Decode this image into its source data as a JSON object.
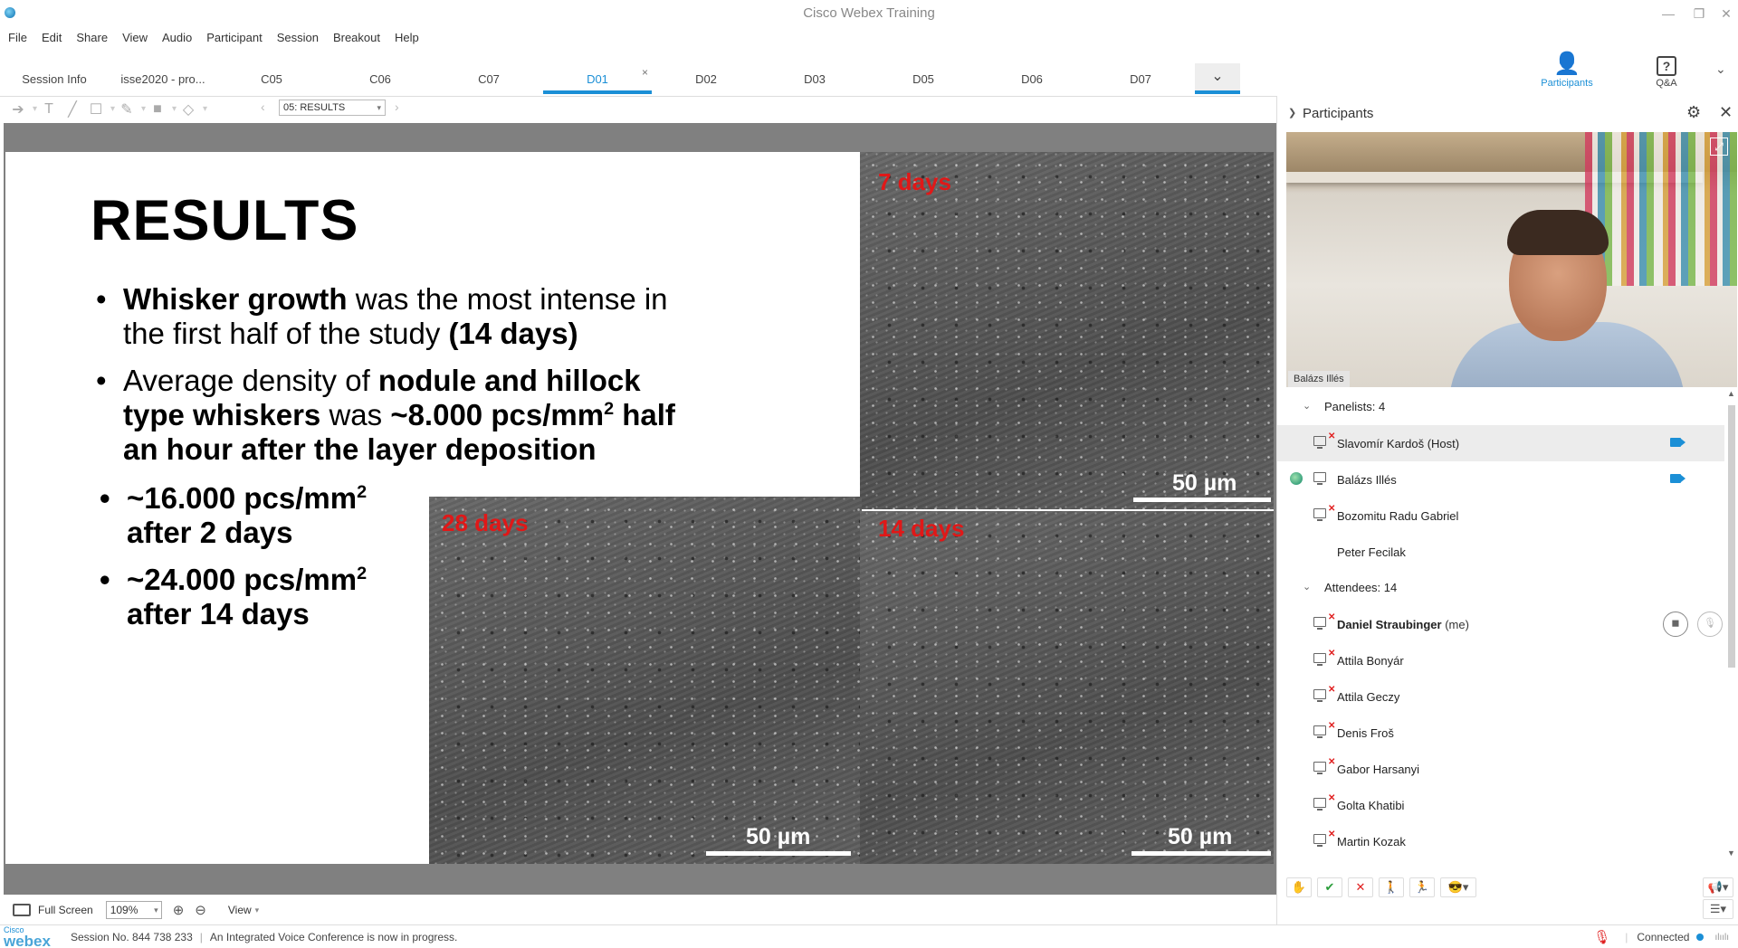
{
  "window": {
    "title": "Cisco Webex Training"
  },
  "menu": [
    "File",
    "Edit",
    "Share",
    "View",
    "Audio",
    "Participant",
    "Session",
    "Breakout",
    "Help"
  ],
  "tabs": [
    {
      "label": "Session Info",
      "active": false
    },
    {
      "label": "isse2020 - pro...",
      "active": false
    },
    {
      "label": "C05",
      "active": false
    },
    {
      "label": "C06",
      "active": false
    },
    {
      "label": "C07",
      "active": false
    },
    {
      "label": "D01",
      "active": true
    },
    {
      "label": "D02",
      "active": false
    },
    {
      "label": "D03",
      "active": false
    },
    {
      "label": "D05",
      "active": false
    },
    {
      "label": "D06",
      "active": false
    },
    {
      "label": "D07",
      "active": false
    }
  ],
  "panel_buttons": {
    "participants": "Participants",
    "qa": "Q&A"
  },
  "toolbar": {
    "page": "05: RESULTS"
  },
  "slide": {
    "title": "RESULTS",
    "b1_bold": "Whisker growth",
    "b1_text": " was the most intense in the first half of the study ",
    "b1_bold2": "(14 days)",
    "b2_text": "Average density of ",
    "b2_bold": "nodule and hillock type whiskers",
    "b2_text2": " was ",
    "b2_bold2": "~8.000 pcs/mm",
    "b2_bold3": " half an hour after the layer deposition",
    "b3_line1": "~16.000 pcs/mm",
    "b3_line2": "after 2 days",
    "b4_line1": "~24.000 pcs/mm",
    "b4_line2": "after 14 days",
    "sup": "2",
    "sem": {
      "d7": "7 days",
      "d14": "14 days",
      "d28": "28 days",
      "scale": "50 µm"
    }
  },
  "bottom": {
    "fullscreen": "Full Screen",
    "zoom": "109%",
    "view": "View"
  },
  "status": {
    "logo_small": "Cisco",
    "logo_big": "webex",
    "session": "Session No. 844 738 233",
    "message": "An Integrated Voice Conference is now in progress.",
    "connected": "Connected"
  },
  "participants": {
    "title": "Participants",
    "video_name": "Balázs Illés",
    "panelists_label": "Panelists: 4",
    "panelists": [
      {
        "name": "Slavomír Kardoš (Host)"
      },
      {
        "name": "Balázs Illés"
      },
      {
        "name": "Bozomitu Radu Gabriel"
      },
      {
        "name": "Peter Fecilak"
      }
    ],
    "attendees_label": "Attendees: 14",
    "me_name": "Daniel Straubinger",
    "me_tag": " (me)",
    "attendees": [
      {
        "name": "Attila Bonyár"
      },
      {
        "name": "Attila Geczy"
      },
      {
        "name": "Denis Froš"
      },
      {
        "name": "Gabor Harsanyi"
      },
      {
        "name": "Golta Khatibi"
      },
      {
        "name": "Martin Kozak"
      }
    ]
  },
  "colors": {
    "accent": "#1b8fd6",
    "sem_label": "#e01818"
  }
}
